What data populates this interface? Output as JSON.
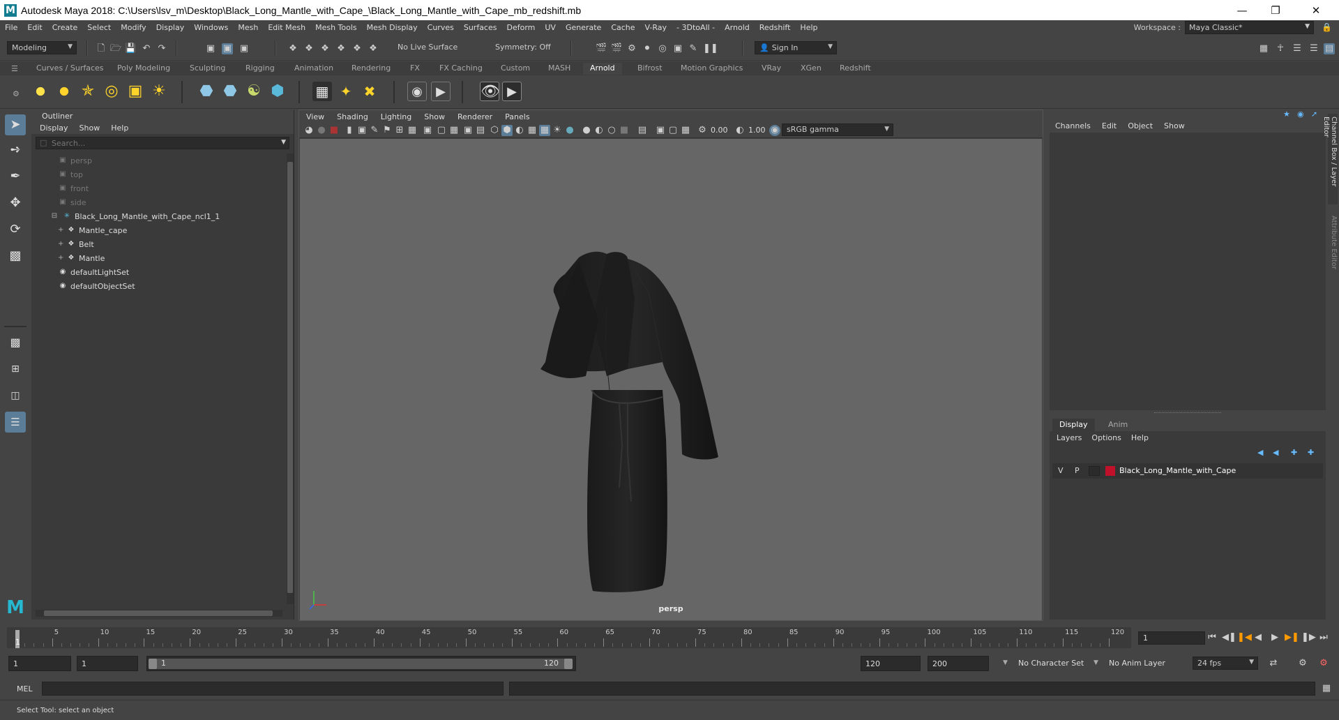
{
  "window": {
    "title": "Autodesk Maya 2018: C:\\Users\\lsv_m\\Desktop\\Black_Long_Mantle_with_Cape_\\Black_Long_Mantle_with_Cape_mb_redshift.mb"
  },
  "menu": [
    "File",
    "Edit",
    "Create",
    "Select",
    "Modify",
    "Display",
    "Windows",
    "Mesh",
    "Edit Mesh",
    "Mesh Tools",
    "Mesh Display",
    "Curves",
    "Surfaces",
    "Deform",
    "UV",
    "Generate",
    "Cache",
    "V-Ray",
    "- 3DtoAll -",
    "Arnold",
    "Redshift",
    "Help"
  ],
  "workspace": {
    "label": "Workspace :",
    "value": "Maya Classic*"
  },
  "status": {
    "mode": "Modeling",
    "live_surface": "No Live Surface",
    "symmetry": "Symmetry: Off",
    "sign_in": "Sign In"
  },
  "shelf_tabs": [
    "Curves / Surfaces",
    "Poly Modeling",
    "Sculpting",
    "Rigging",
    "Animation",
    "Rendering",
    "FX",
    "FX Caching",
    "Custom",
    "MASH",
    "Arnold",
    "Bifrost",
    "Motion Graphics",
    "VRay",
    "XGen",
    "Redshift"
  ],
  "shelf_active": "Arnold",
  "outliner": {
    "title": "Outliner",
    "menu": [
      "Display",
      "Show",
      "Help"
    ],
    "search_placeholder": "Search...",
    "items": [
      {
        "label": "persp",
        "dim": true
      },
      {
        "label": "top",
        "dim": true
      },
      {
        "label": "front",
        "dim": true
      },
      {
        "label": "side",
        "dim": true
      },
      {
        "label": "Black_Long_Mantle_with_Cape_ncl1_1",
        "dim": false
      },
      {
        "label": "Mantle_cape",
        "dim": false
      },
      {
        "label": "Belt",
        "dim": false
      },
      {
        "label": "Mantle",
        "dim": false
      },
      {
        "label": "defaultLightSet",
        "dim": false
      },
      {
        "label": "defaultObjectSet",
        "dim": false
      }
    ]
  },
  "viewport": {
    "menu": [
      "View",
      "Shading",
      "Lighting",
      "Show",
      "Renderer",
      "Panels"
    ],
    "exposure": "0.00",
    "gamma": "1.00",
    "colorspace": "sRGB gamma",
    "camera_label": "persp"
  },
  "channel_box": {
    "menu": [
      "Channels",
      "Edit",
      "Object",
      "Show"
    ],
    "side_tab1": "Channel Box / Layer Editor",
    "side_tab2": "Attribute Editor"
  },
  "layer_editor": {
    "tabs": [
      "Display",
      "Anim"
    ],
    "menu": [
      "Layers",
      "Options",
      "Help"
    ],
    "layer": {
      "v": "V",
      "p": "P",
      "name": "Black_Long_Mantle_with_Cape",
      "color": "#c0102a"
    }
  },
  "timeline": {
    "ticks": [
      "5",
      "10",
      "15",
      "20",
      "25",
      "30",
      "35",
      "40",
      "45",
      "50",
      "55",
      "60",
      "65",
      "70",
      "75",
      "80",
      "85",
      "90",
      "95",
      "100",
      "105",
      "110",
      "115",
      "120"
    ],
    "start_tick": "1",
    "current_frame": "1"
  },
  "range": {
    "start": "1",
    "anim_start": "1",
    "range_start": "1",
    "range_end": "120",
    "end": "120",
    "anim_end": "200",
    "character_set": "No Character Set",
    "anim_layer": "No Anim Layer",
    "fps": "24 fps"
  },
  "cmd": {
    "label": "MEL"
  },
  "help": {
    "text": "Select Tool: select an object"
  }
}
